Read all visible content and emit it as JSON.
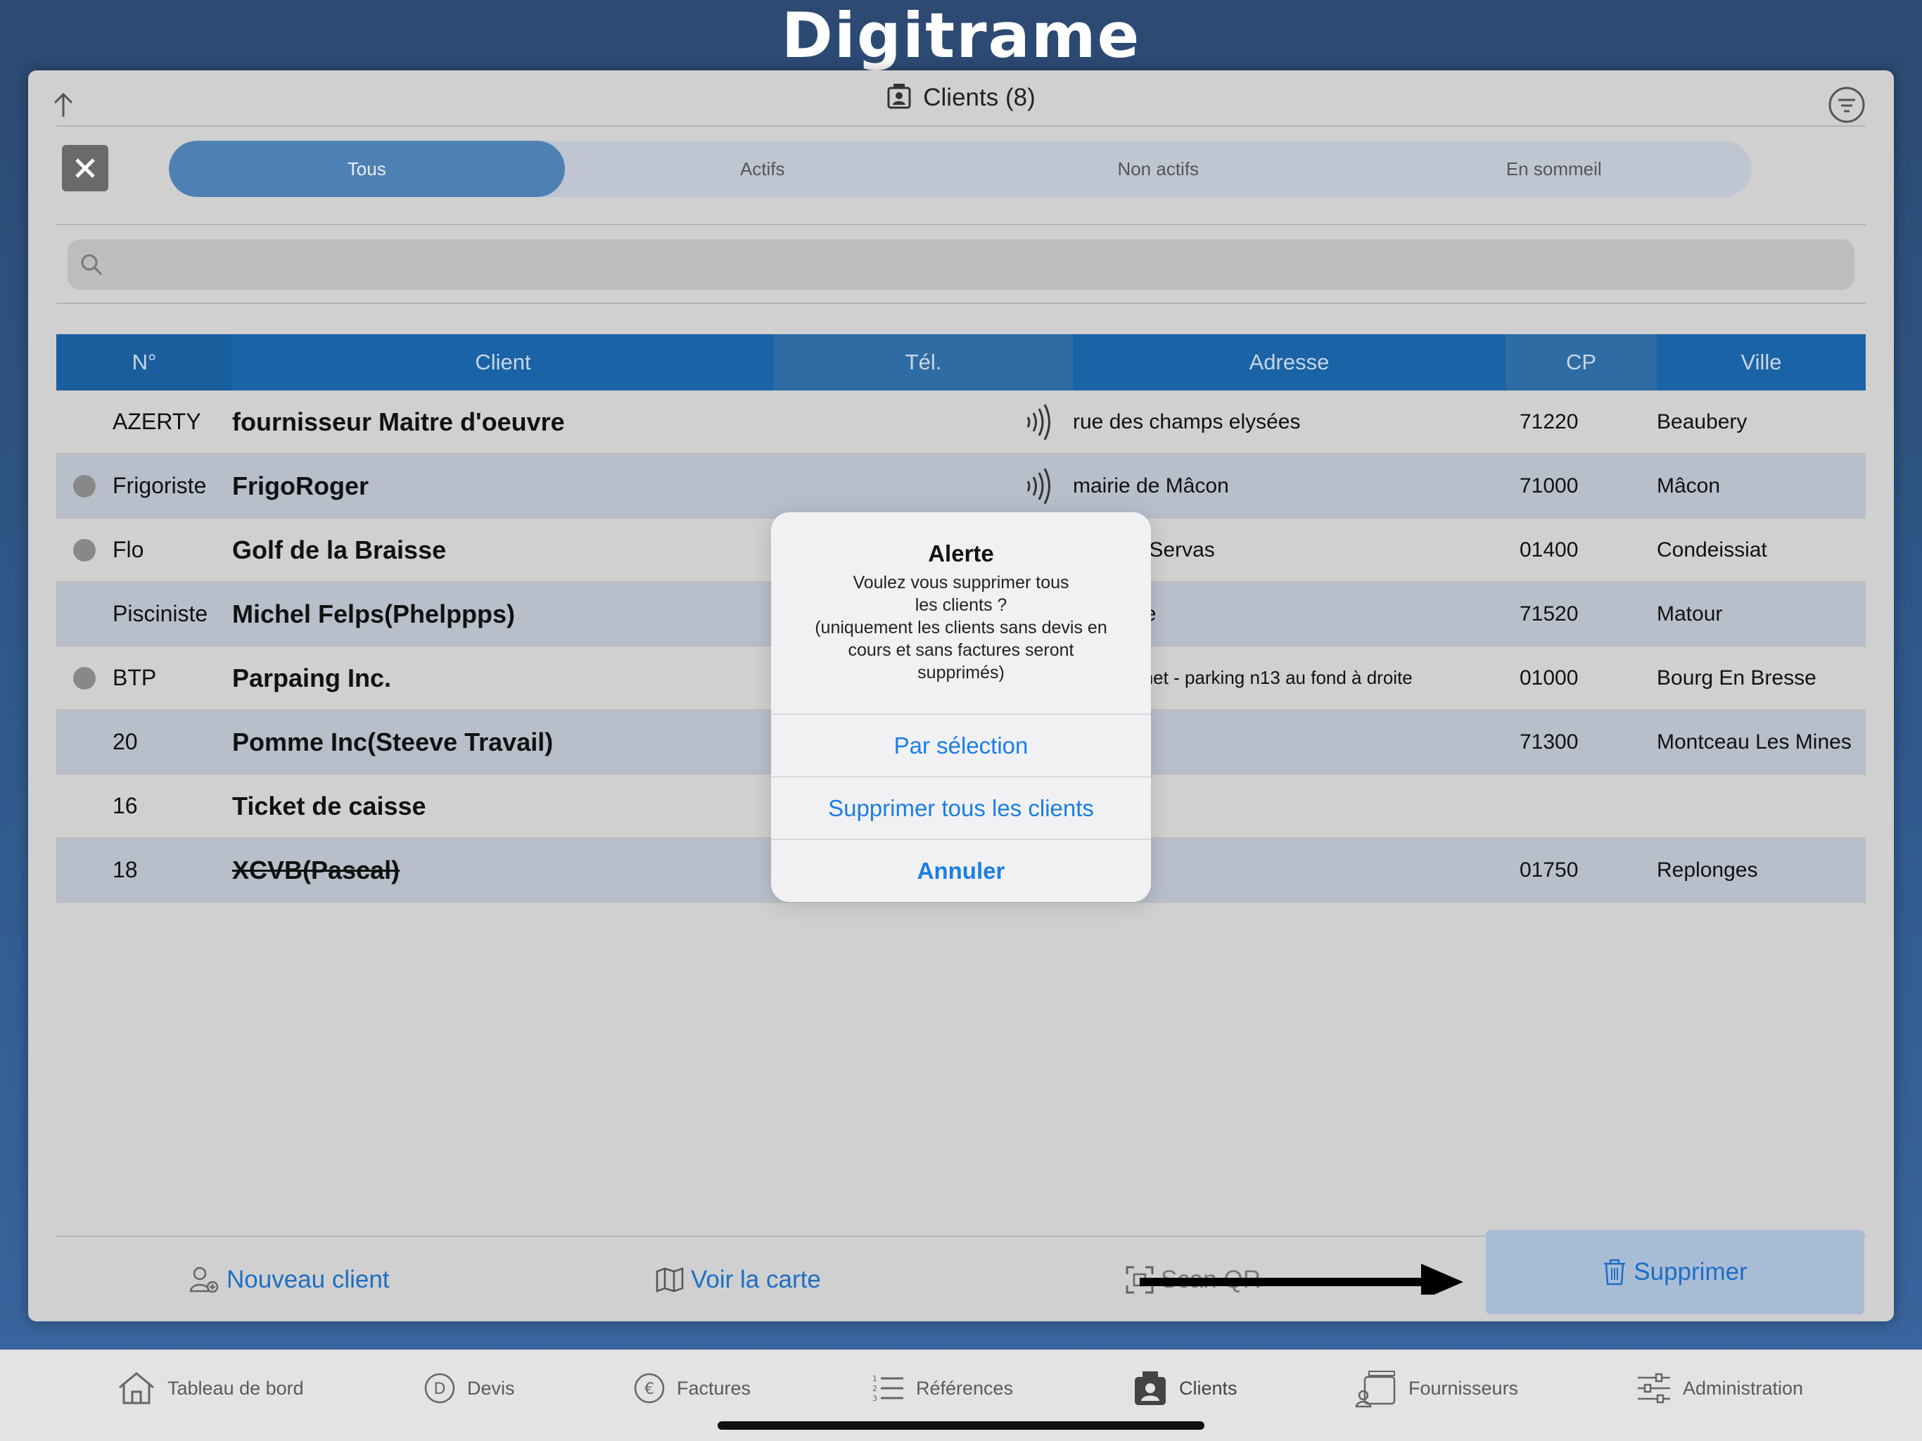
{
  "app": {
    "logo": "Digitrame"
  },
  "header": {
    "title": "Clients (8)"
  },
  "segments": [
    {
      "label": "Tous",
      "active": true
    },
    {
      "label": "Actifs",
      "active": false
    },
    {
      "label": "Non actifs",
      "active": false
    },
    {
      "label": "En sommeil",
      "active": false
    }
  ],
  "search": {
    "placeholder": ""
  },
  "table": {
    "columns": {
      "num": "N°",
      "client": "Client",
      "tel": "Tél.",
      "adresse": "Adresse",
      "cp": "CP",
      "ville": "Ville"
    },
    "rows": [
      {
        "dot": false,
        "num": "AZERTY",
        "client": "fournisseur Maitre d'oeuvre",
        "tel_icon": true,
        "adresse": "rue des champs elysées",
        "cp": "71220",
        "ville": "Beaubery"
      },
      {
        "dot": true,
        "num": "Frigoriste",
        "client": "FrigoRoger",
        "tel_icon": true,
        "adresse": "mairie de Mâcon",
        "cp": "71000",
        "ville": "Mâcon"
      },
      {
        "dot": true,
        "num": "Flo",
        "client": "Golf de la Braisse",
        "tel_icon": false,
        "adresse": "",
        "adresse_visible": "oute de Servas",
        "cp": "01400",
        "ville": "Condeissiat"
      },
      {
        "dot": false,
        "num": "Pisciniste",
        "client": "Michel Felps(Phelppps)",
        "tel_icon": false,
        "adresse_visible": "a piscine",
        "cp": "71520",
        "ville": "Matour"
      },
      {
        "dot": true,
        "num": "BTP",
        "client": "Parpaing Inc.",
        "tel_icon": false,
        "adresse_visible": "dgar Quinet - parking n13 au fond à droite",
        "cp": "01000",
        "ville": "Bourg En Bresse"
      },
      {
        "dot": false,
        "num": "20",
        "client": "Pomme Inc(Steeve Travail)",
        "tel_icon": false,
        "adresse_visible": "",
        "cp": "71300",
        "ville": "Montceau Les Mines"
      },
      {
        "dot": false,
        "num": "16",
        "client": "Ticket de caisse",
        "tel_icon": false,
        "adresse_visible": "",
        "cp": "",
        "ville": ""
      },
      {
        "dot": false,
        "num": "18",
        "client": "XCVB(Pascal)",
        "strike": true,
        "tel_icon": false,
        "adresse_visible": "",
        "cp": "01750",
        "ville": "Replonges"
      }
    ]
  },
  "toolbar": {
    "new_client": "Nouveau client",
    "map": "Voir la carte",
    "scan": "Scan QR",
    "delete": "Supprimer"
  },
  "alert": {
    "title": "Alerte",
    "message_l1": "Voulez vous supprimer tous",
    "message_l2": "les clients ?",
    "message_l3": "(uniquement les clients sans devis en",
    "message_l4": "cours et sans factures seront",
    "message_l5": "supprimés)",
    "btn_selection": "Par sélection",
    "btn_delete_all": "Supprimer tous les clients",
    "btn_cancel": "Annuler"
  },
  "tabbar": [
    {
      "label": "Tableau de bord",
      "icon": "home-icon"
    },
    {
      "label": "Devis",
      "icon": "devis-icon"
    },
    {
      "label": "Factures",
      "icon": "euro-icon"
    },
    {
      "label": "Références",
      "icon": "list-icon"
    },
    {
      "label": "Clients",
      "icon": "clients-icon",
      "active": true
    },
    {
      "label": "Fournisseurs",
      "icon": "suppliers-icon"
    },
    {
      "label": "Administration",
      "icon": "sliders-icon"
    }
  ],
  "colors": {
    "accent": "#1d6fc4",
    "header_blue": "#1a5e9e",
    "segment_active": "#4f80b3"
  }
}
